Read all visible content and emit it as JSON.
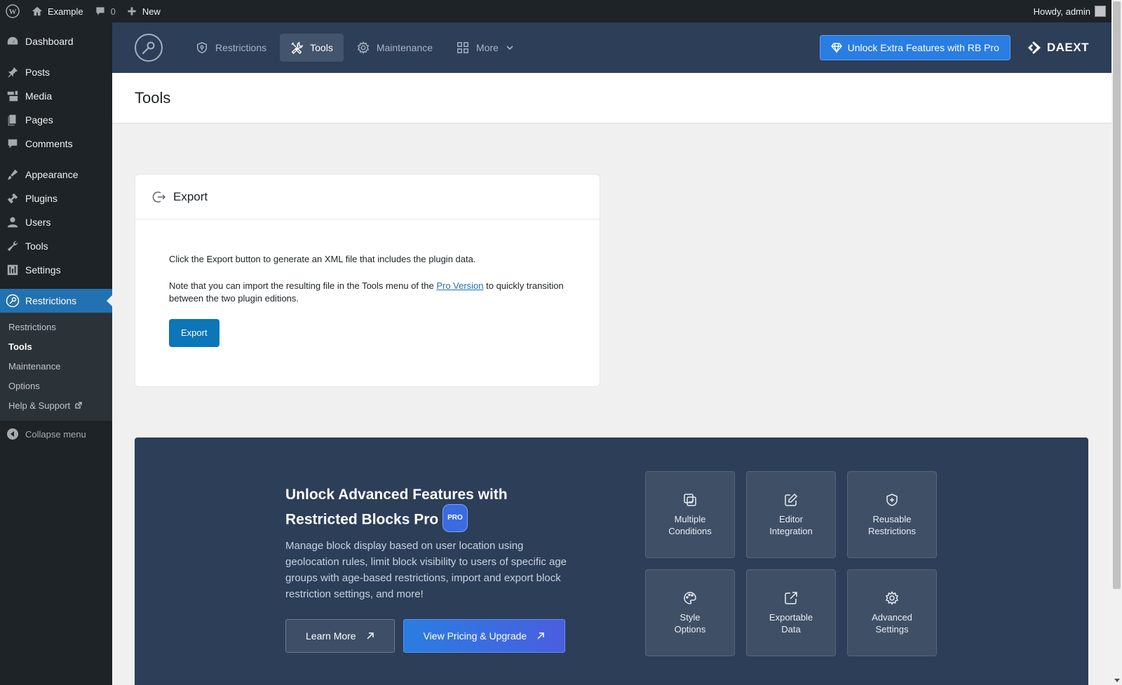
{
  "admin_bar": {
    "site_name": "Example",
    "comments_count": "0",
    "new_label": "New",
    "howdy": "Howdy, admin"
  },
  "menu": {
    "items": [
      {
        "label": "Dashboard",
        "icon": "dashboard-icon"
      },
      {
        "label": "Posts",
        "icon": "pin-icon"
      },
      {
        "label": "Media",
        "icon": "media-icon"
      },
      {
        "label": "Pages",
        "icon": "pages-icon"
      },
      {
        "label": "Comments",
        "icon": "comment-icon"
      },
      {
        "label": "Appearance",
        "icon": "brush-icon"
      },
      {
        "label": "Plugins",
        "icon": "plugin-icon"
      },
      {
        "label": "Users",
        "icon": "user-icon"
      },
      {
        "label": "Tools",
        "icon": "wrench-icon"
      },
      {
        "label": "Settings",
        "icon": "settings-icon"
      },
      {
        "label": "Restrictions",
        "icon": "key-icon"
      }
    ],
    "submenu": [
      "Restrictions",
      "Tools",
      "Maintenance",
      "Options",
      "Help & Support"
    ],
    "collapse_label": "Collapse menu"
  },
  "plugin_header": {
    "tabs": [
      "Restrictions",
      "Tools",
      "Maintenance",
      "More"
    ],
    "active_tab": "Tools",
    "unlock_label": "Unlock Extra Features with RB Pro",
    "brand": "DAEXT"
  },
  "page": {
    "title": "Tools"
  },
  "export_card": {
    "title": "Export",
    "text1": "Click the Export button to generate an XML file that includes the plugin data.",
    "text2_before": "Note that you can import the resulting file in the Tools menu of the ",
    "text2_link": "Pro Version",
    "text2_after": " to quickly transition between the two plugin editions.",
    "button": "Export"
  },
  "upsell": {
    "title": "Unlock Advanced Features with Restricted Blocks Pro",
    "badge": "PRO",
    "description": "Manage block display based on user location using geolocation rules, limit block visibility to users of specific age groups with age-based restrictions, import and export block restriction settings, and more!",
    "learn_more": "Learn More",
    "pricing": "View Pricing & Upgrade",
    "features": [
      {
        "label": "Multiple\nConditions",
        "icon": "copy-check-icon"
      },
      {
        "label": "Editor\nIntegration",
        "icon": "edit-icon"
      },
      {
        "label": "Reusable\nRestrictions",
        "icon": "shield-plus-icon"
      },
      {
        "label": "Style\nOptions",
        "icon": "palette-icon"
      },
      {
        "label": "Exportable\nData",
        "icon": "export-icon"
      },
      {
        "label": "Advanced\nSettings",
        "icon": "gear-icon"
      }
    ]
  },
  "colors": {
    "admin_dark": "#1d2327",
    "accent": "#2271b1",
    "plugin_header": "#2c3e58",
    "upgrade_blue": "#2a7de1"
  }
}
